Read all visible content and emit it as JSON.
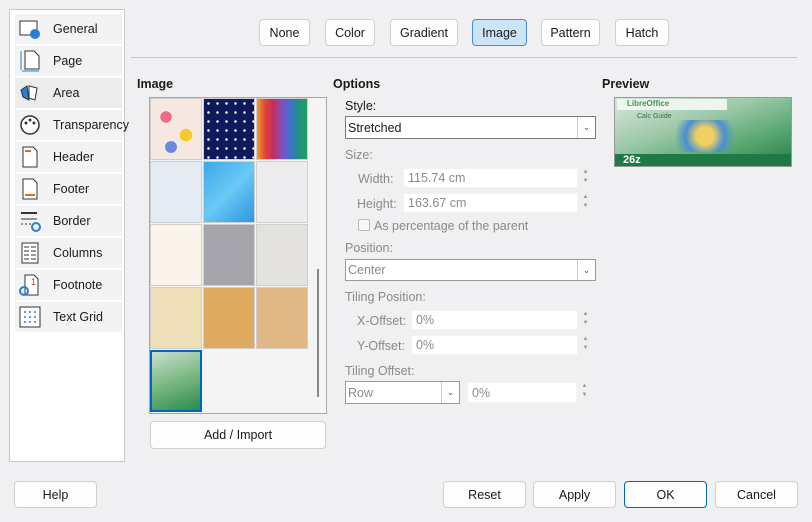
{
  "sidebar": {
    "items": [
      {
        "label": "General",
        "icon": "general-icon"
      },
      {
        "label": "Page",
        "icon": "page-icon"
      },
      {
        "label": "Area",
        "icon": "area-icon"
      },
      {
        "label": "Transparency",
        "icon": "transparency-icon"
      },
      {
        "label": "Header",
        "icon": "header-icon"
      },
      {
        "label": "Footer",
        "icon": "footer-icon"
      },
      {
        "label": "Border",
        "icon": "border-icon"
      },
      {
        "label": "Columns",
        "icon": "columns-icon"
      },
      {
        "label": "Footnote",
        "icon": "footnote-icon"
      },
      {
        "label": "Text Grid",
        "icon": "text-grid-icon"
      }
    ],
    "selected": "Area"
  },
  "fill_tabs": [
    "None",
    "Color",
    "Gradient",
    "Image",
    "Pattern",
    "Hatch"
  ],
  "selected_fill": "Image",
  "image": {
    "heading": "Image",
    "add_import": "Add / Import"
  },
  "options": {
    "heading": "Options",
    "style_label": "Style:",
    "style_value": "Stretched",
    "size_label": "Size:",
    "width_label": "Width:",
    "width_value": "115.74 cm",
    "height_label": "Height:",
    "height_value": "163.67 cm",
    "percentage_label": "As percentage of the parent",
    "position_label": "Position:",
    "position_value": "Center",
    "tiling_position_label": "Tiling Position:",
    "x_offset_label": "X-Offset:",
    "x_offset_value": "0%",
    "y_offset_label": "Y-Offset:",
    "y_offset_value": "0%",
    "tiling_offset_label": "Tiling Offset:",
    "tiling_offset_mode": "Row",
    "tiling_offset_value": "0%"
  },
  "preview": {
    "heading": "Preview",
    "logo_text": "LibreOffice",
    "subtitle": "Calc Guide",
    "number": "26z"
  },
  "footer": {
    "help": "Help",
    "reset": "Reset",
    "apply": "Apply",
    "ok": "OK",
    "cancel": "Cancel"
  },
  "colors": {
    "accent": "#0067c0",
    "selected_tab_bg": "#cce4f7"
  }
}
